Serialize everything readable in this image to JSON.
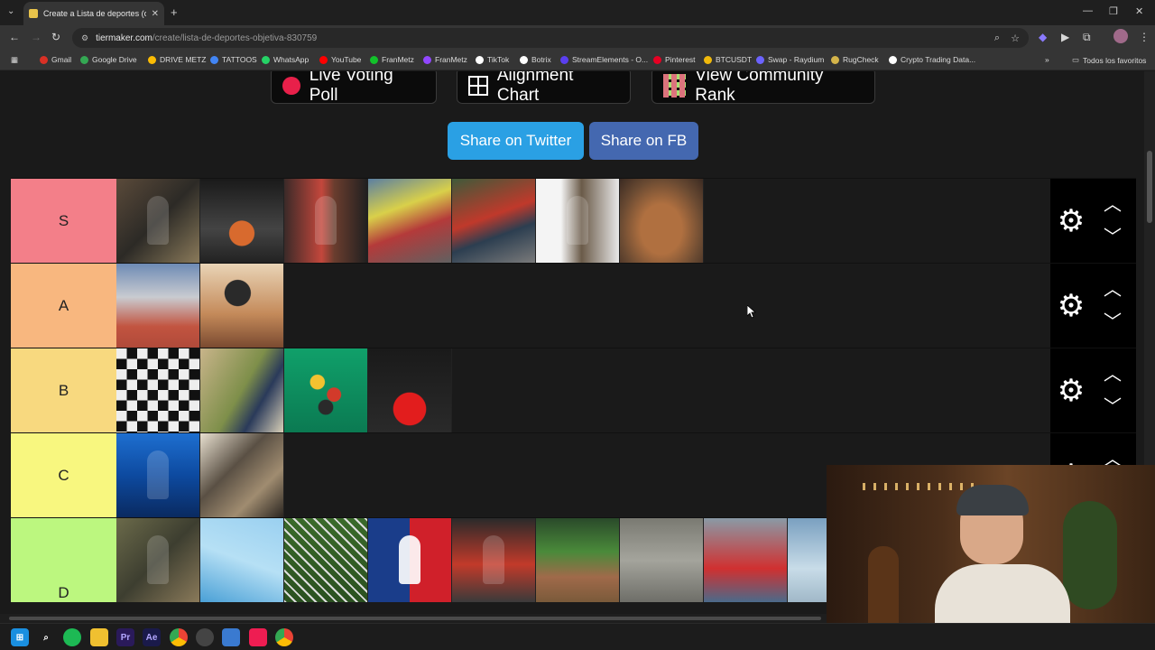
{
  "browser": {
    "tab_title": "Create a Lista de deportes (obj",
    "tab_close": "✕",
    "new_tab": "+",
    "url_domain": "tiermaker.com",
    "url_path": "/create/lista-de-deportes-objetiva-830759",
    "window_controls": [
      "—",
      "❐",
      "✕"
    ]
  },
  "bookmarks": {
    "items": [
      {
        "label": "Gmail",
        "color": "#d93025"
      },
      {
        "label": "Google Drive",
        "color": "#34a853"
      },
      {
        "label": "DRIVE METZ",
        "color": "#fbbc04"
      },
      {
        "label": "TATTOOS",
        "color": "#4285f4"
      },
      {
        "label": "WhatsApp",
        "color": "#25d366"
      },
      {
        "label": "YouTube",
        "color": "#ff0000"
      },
      {
        "label": "FranMetz",
        "color": "#12c22a"
      },
      {
        "label": "FranMetz",
        "color": "#9147ff"
      },
      {
        "label": "TikTok",
        "color": "#ffffff"
      },
      {
        "label": "Botrix",
        "color": "#ffffff"
      },
      {
        "label": "StreamElements - O...",
        "color": "#5a3ff0"
      },
      {
        "label": "Pinterest",
        "color": "#e60023"
      },
      {
        "label": "BTCUSDT",
        "color": "#f0b90b"
      },
      {
        "label": "Swap - Raydium",
        "color": "#6c63ff"
      },
      {
        "label": "RugCheck",
        "color": "#d4b44a"
      },
      {
        "label": "Crypto Trading Data...",
        "color": "#ffffff"
      }
    ],
    "overflow": "»",
    "all_bookmarks": "Todos los favoritos"
  },
  "toolbar": {
    "live_voting": "Live Voting Poll",
    "alignment_chart": "Alignment Chart",
    "community_rank": "View Community Rank",
    "share_twitter": "Share on Twitter",
    "share_fb": "Share on FB"
  },
  "colors": {
    "twitter": "#2aa0e4",
    "facebook": "#4468b0",
    "tier_s": "#f37f89",
    "tier_a": "#f8b77f",
    "tier_b": "#f8d97f",
    "tier_c": "#f8f77f",
    "tier_d": "#bcf77f"
  },
  "tiers": [
    {
      "label": "S",
      "count": 7
    },
    {
      "label": "A",
      "count": 2
    },
    {
      "label": "B",
      "count": 4
    },
    {
      "label": "C",
      "count": 2
    },
    {
      "label": "D",
      "count": 9
    }
  ],
  "controls": {
    "gear_icon": "gear-icon",
    "up_icon": "chevron-up-icon",
    "down_icon": "chevron-down-icon"
  },
  "taskbar": {
    "items": [
      "windows-start-icon",
      "search-icon",
      "spotify-icon",
      "file-explorer-icon",
      "premiere-icon",
      "after-effects-icon",
      "chrome-icon",
      "obs-icon",
      "photos-icon",
      "tiktok-icon",
      "chrome-active-icon"
    ]
  }
}
